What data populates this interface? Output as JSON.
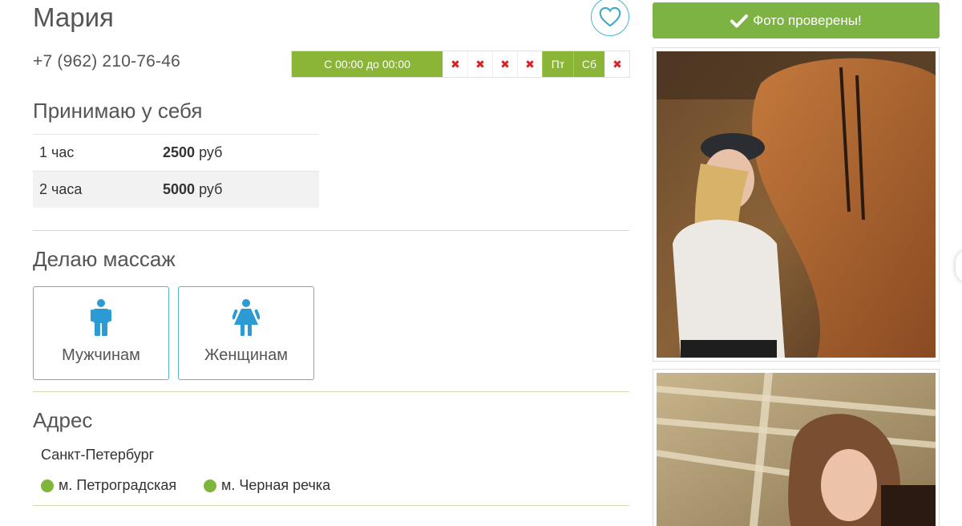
{
  "profile": {
    "name": "Мария",
    "phone": "+7 (962) 210-76-46"
  },
  "schedule": {
    "time_label": "С 00:00 до 00:00",
    "days": [
      {
        "label": "✖",
        "active": false
      },
      {
        "label": "✖",
        "active": false
      },
      {
        "label": "✖",
        "active": false
      },
      {
        "label": "✖",
        "active": false
      },
      {
        "label": "Пт",
        "active": true
      },
      {
        "label": "Сб",
        "active": true
      },
      {
        "label": "✖",
        "active": false
      }
    ]
  },
  "incall": {
    "title": "Принимаю у себя",
    "prices": [
      {
        "duration": "1 час",
        "amount": "2500",
        "currency": "руб"
      },
      {
        "duration": "2 часа",
        "amount": "5000",
        "currency": "руб"
      }
    ]
  },
  "massage": {
    "title": "Делаю массаж",
    "options": [
      {
        "label": "Мужчинам",
        "icon": "male-icon"
      },
      {
        "label": "Женщинам",
        "icon": "female-icon"
      }
    ]
  },
  "address": {
    "title": "Адрес",
    "city": "Санкт-Петербург",
    "metro": [
      "м. Петроградская",
      "м. Черная речка"
    ]
  },
  "sidebar": {
    "verified_label": "Фото проверены!"
  },
  "colors": {
    "accent_green": "#8ab536",
    "verified_green": "#7cb342",
    "accent_blue": "#4fb3cc",
    "cross_red": "#dd1f26"
  }
}
